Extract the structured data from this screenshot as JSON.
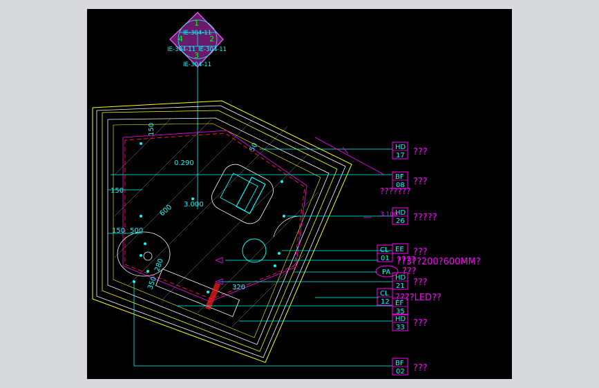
{
  "colors": {
    "background": "#000000",
    "frame": "#d8d9dd",
    "cyan": "#00ffff",
    "magenta": "#ff00ff",
    "yellow": "#ffff00",
    "white": "#ffffff",
    "red": "#ff2020",
    "green": "#00ff00",
    "purple": "#7a1a7a"
  },
  "section_marker": {
    "numbers": [
      "1",
      "2",
      "3",
      "4"
    ],
    "refs": [
      "IE-304-11",
      "IE-304-11",
      "IE-304-11",
      "IE-304-11"
    ]
  },
  "dimensions": {
    "d150_top": "150",
    "d0290": "0.290",
    "d3000": "3.000",
    "d600": "600",
    "d150_left": "150",
    "d150_mid": "150",
    "d500": "500",
    "d320": "320",
    "d50": "50",
    "d280": "280",
    "d350": "350"
  },
  "tags": [
    {
      "code": "HD",
      "num": "17",
      "note": "???"
    },
    {
      "code": "BF",
      "num": "08",
      "note": "???",
      "extra": "???????"
    },
    {
      "code": "HD",
      "num": "26",
      "note": "?????",
      "extra": "3.100"
    },
    {
      "code": "EE",
      "num": "",
      "note": "???"
    },
    {
      "code": "CL",
      "num": "01",
      "note": "????",
      "extra": "??3??200?600MM?"
    },
    {
      "code": "PA",
      "num": "",
      "note": "???"
    },
    {
      "code": "HD",
      "num": "21",
      "note": "???"
    },
    {
      "code": "CL",
      "num": "12",
      "note": "????LED??"
    },
    {
      "code": "EF",
      "num": "35",
      "note": ""
    },
    {
      "code": "HD",
      "num": "33",
      "note": "???"
    },
    {
      "code": "BF",
      "num": "02",
      "note": "???"
    }
  ]
}
